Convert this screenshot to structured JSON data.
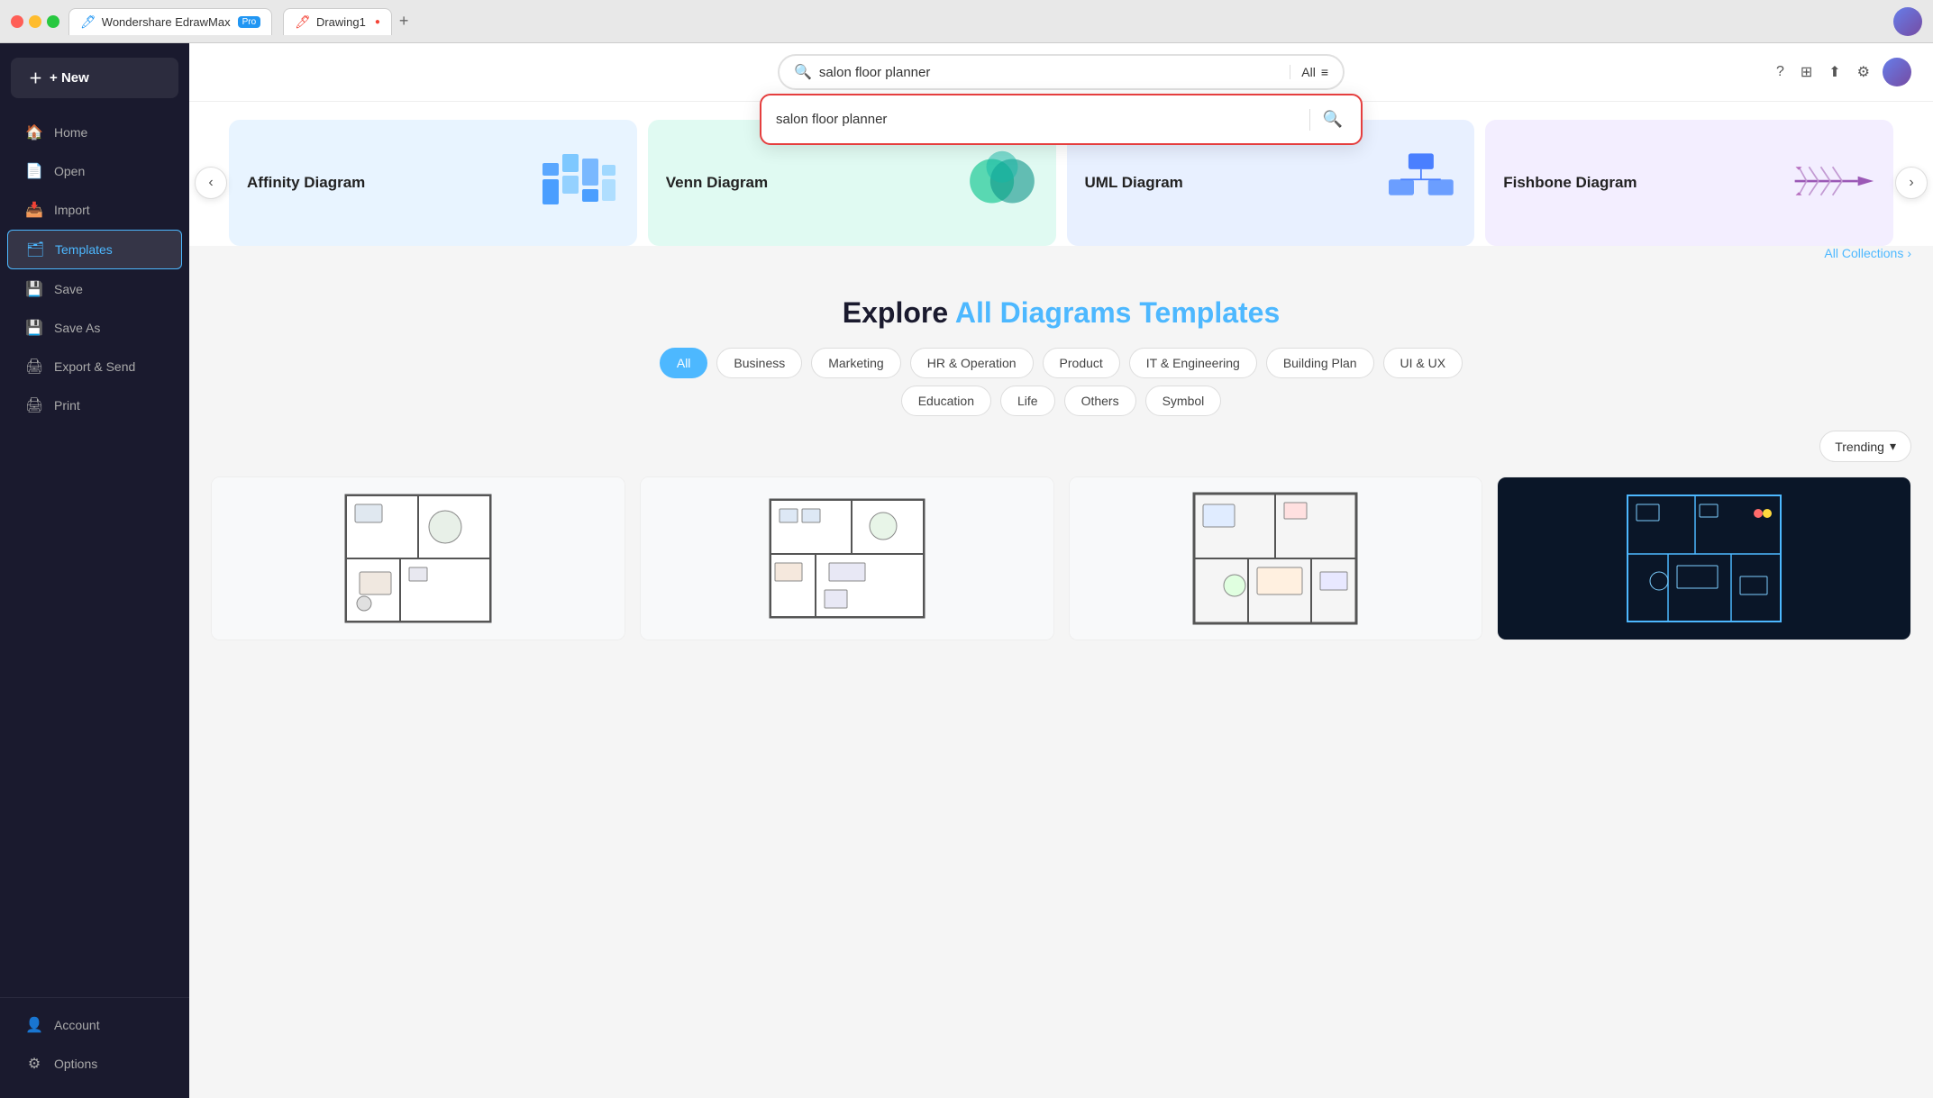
{
  "browser": {
    "app_name": "Wondershare EdrawMax",
    "app_badge": "Pro",
    "tab_title": "Drawing1",
    "tab_close_char": "●"
  },
  "topbar_icons": {
    "help": "?",
    "grid": "⊞",
    "share": "⬆",
    "settings": "⚙"
  },
  "sidebar": {
    "new_label": "+ New",
    "items": [
      {
        "id": "home",
        "label": "Home",
        "icon": "🏠"
      },
      {
        "id": "open",
        "label": "Open",
        "icon": "📄"
      },
      {
        "id": "import",
        "label": "Import",
        "icon": "📥"
      },
      {
        "id": "templates",
        "label": "Templates",
        "icon": "🗂",
        "active": true
      },
      {
        "id": "save",
        "label": "Save",
        "icon": "💾"
      },
      {
        "id": "save-as",
        "label": "Save As",
        "icon": "💾"
      },
      {
        "id": "export",
        "label": "Export & Send",
        "icon": "🖨"
      },
      {
        "id": "print",
        "label": "Print",
        "icon": "🖨"
      }
    ],
    "bottom_items": [
      {
        "id": "account",
        "label": "Account",
        "icon": "👤"
      },
      {
        "id": "options",
        "label": "Options",
        "icon": "⚙"
      }
    ]
  },
  "search": {
    "placeholder": "salon floor planner",
    "value": "salon floor planner",
    "dropdown_value": "salon floor planner",
    "all_label": "All",
    "search_btn": "🔍"
  },
  "hero": {
    "prev_label": "‹",
    "next_label": "›",
    "all_collections": "All Collections",
    "cards": [
      {
        "id": "affinity",
        "label": "Affinity Diagram",
        "type": "affinity"
      },
      {
        "id": "venn",
        "label": "Venn Diagram",
        "type": "venn"
      },
      {
        "id": "uml",
        "label": "UML Diagram",
        "type": "uml"
      },
      {
        "id": "fishbone",
        "label": "Fishbone Diagram",
        "type": "fishbone"
      }
    ]
  },
  "explore": {
    "title_plain": "Explore ",
    "title_colored": "All Diagrams Templates"
  },
  "filters": {
    "items": [
      {
        "id": "all",
        "label": "All",
        "active": true
      },
      {
        "id": "business",
        "label": "Business",
        "active": false
      },
      {
        "id": "marketing",
        "label": "Marketing",
        "active": false
      },
      {
        "id": "hr",
        "label": "HR & Operation",
        "active": false
      },
      {
        "id": "product",
        "label": "Product",
        "active": false
      },
      {
        "id": "it",
        "label": "IT & Engineering",
        "active": false
      },
      {
        "id": "building",
        "label": "Building Plan",
        "active": false
      },
      {
        "id": "uiux",
        "label": "UI & UX",
        "active": false
      },
      {
        "id": "education",
        "label": "Education",
        "active": false
      },
      {
        "id": "life",
        "label": "Life",
        "active": false
      },
      {
        "id": "others",
        "label": "Others",
        "active": false
      },
      {
        "id": "symbol",
        "label": "Symbol",
        "active": false
      }
    ]
  },
  "sort": {
    "label": "Trending",
    "arrow": "▾"
  },
  "templates": {
    "cards": [
      {
        "id": "t1",
        "type": "floor-light"
      },
      {
        "id": "t2",
        "type": "floor-light"
      },
      {
        "id": "t3",
        "type": "floor-light"
      },
      {
        "id": "t4",
        "type": "floor-dark"
      }
    ]
  }
}
